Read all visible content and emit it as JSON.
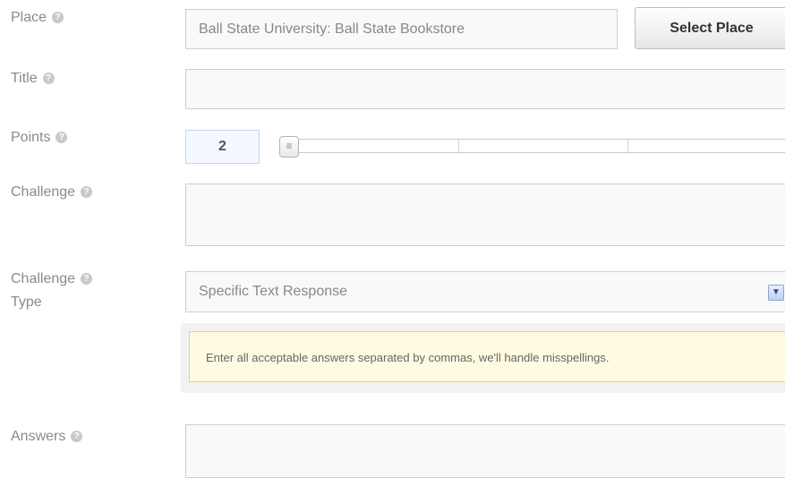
{
  "form": {
    "place": {
      "label": "Place",
      "value": "Ball State University: Ball State Bookstore",
      "button": "Select Place"
    },
    "title": {
      "label": "Title",
      "value": ""
    },
    "points": {
      "label": "Points",
      "value": "2",
      "slider_value": 2
    },
    "challenge": {
      "label": "Challenge",
      "value": ""
    },
    "challenge_type": {
      "label_line1": "Challenge",
      "label_line2": "Type",
      "selected": "Specific Text Response",
      "hint": "Enter all acceptable answers separated by commas, we'll handle misspellings."
    },
    "answers": {
      "label": "Answers",
      "value": ""
    }
  },
  "icons": {
    "help": "help-question-icon",
    "dropdown": "chevron-down-icon",
    "slider_handle": "grip-lines-icon"
  },
  "colors": {
    "hint_border": "#f0d060",
    "hint_bg": "#fffbe0",
    "points_bg": "#f4f8ff"
  }
}
